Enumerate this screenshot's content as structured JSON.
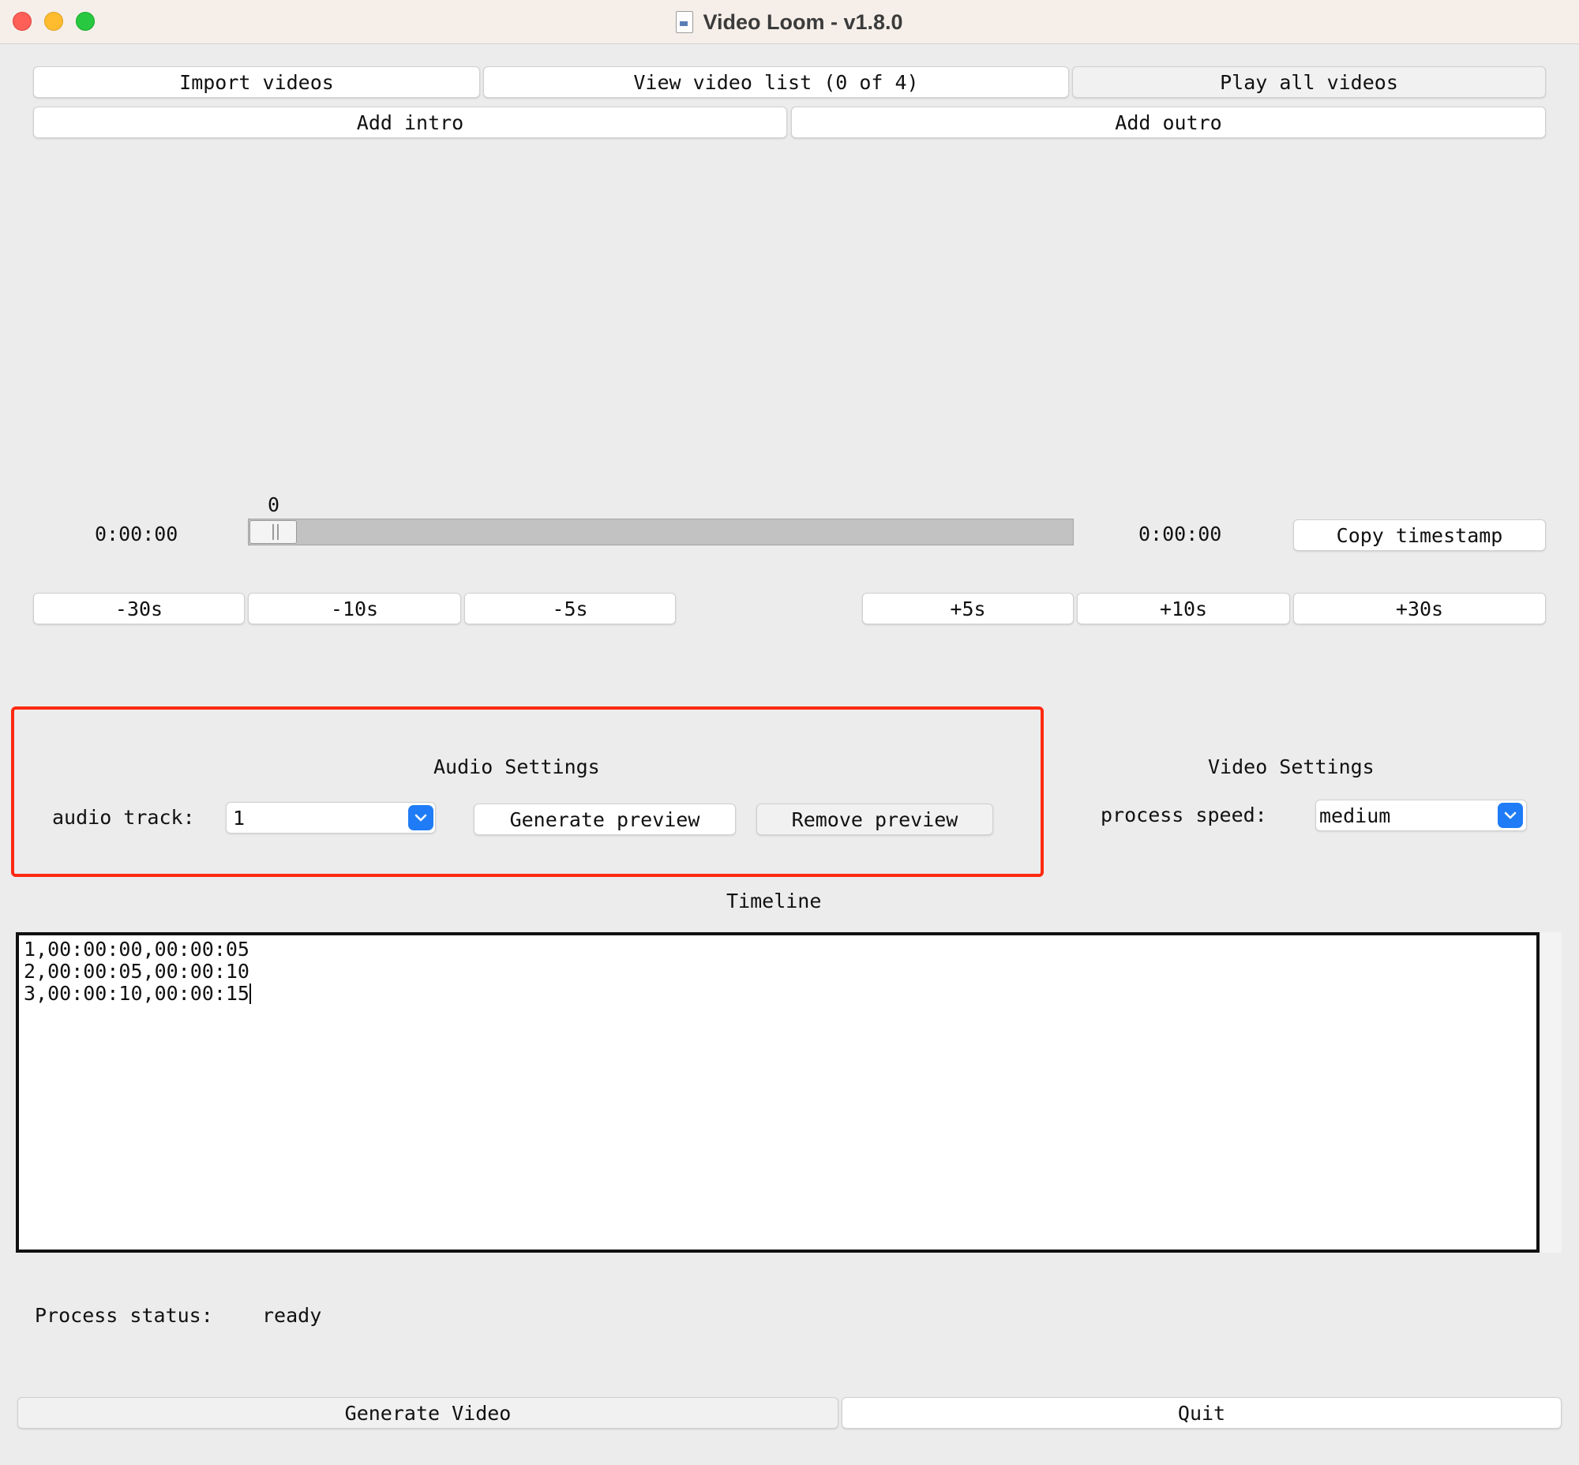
{
  "window": {
    "title": "Video Loom - v1.8.0"
  },
  "toolbar": {
    "import_videos": "Import videos",
    "view_video_list": "View video list (0 of 4)",
    "play_all_videos": "Play all videos",
    "add_intro": "Add intro",
    "add_outro": "Add outro"
  },
  "player": {
    "slider_value_label": "0",
    "current_time": "0:00:00",
    "end_time": "0:00:00",
    "copy_timestamp": "Copy timestamp",
    "slider_position": 0
  },
  "seek_buttons": {
    "minus_30": "-30s",
    "minus_10": "-10s",
    "minus_5": "-5s",
    "plus_5": "+5s",
    "plus_10": "+10s",
    "plus_30": "+30s"
  },
  "audio_settings": {
    "heading": "Audio Settings",
    "track_label": "audio track:",
    "track_value": "1",
    "generate_preview": "Generate preview",
    "remove_preview": "Remove preview"
  },
  "video_settings": {
    "heading": "Video Settings",
    "speed_label": "process speed:",
    "speed_value": "medium"
  },
  "timeline": {
    "heading": "Timeline",
    "lines": [
      "1,00:00:00,00:00:05",
      "2,00:00:05,00:00:10",
      "3,00:00:10,00:00:15"
    ]
  },
  "status": {
    "label": "Process status:",
    "value": "ready"
  },
  "footer": {
    "generate_video": "Generate Video",
    "quit": "Quit"
  },
  "colors": {
    "highlight_border": "#ff2a12",
    "dropdown_accent": "#1f7cf6",
    "window_background": "#ececec"
  },
  "icons": [
    "close-window-icon",
    "minimize-window-icon",
    "zoom-window-icon",
    "document-icon",
    "chevron-down-icon"
  ]
}
